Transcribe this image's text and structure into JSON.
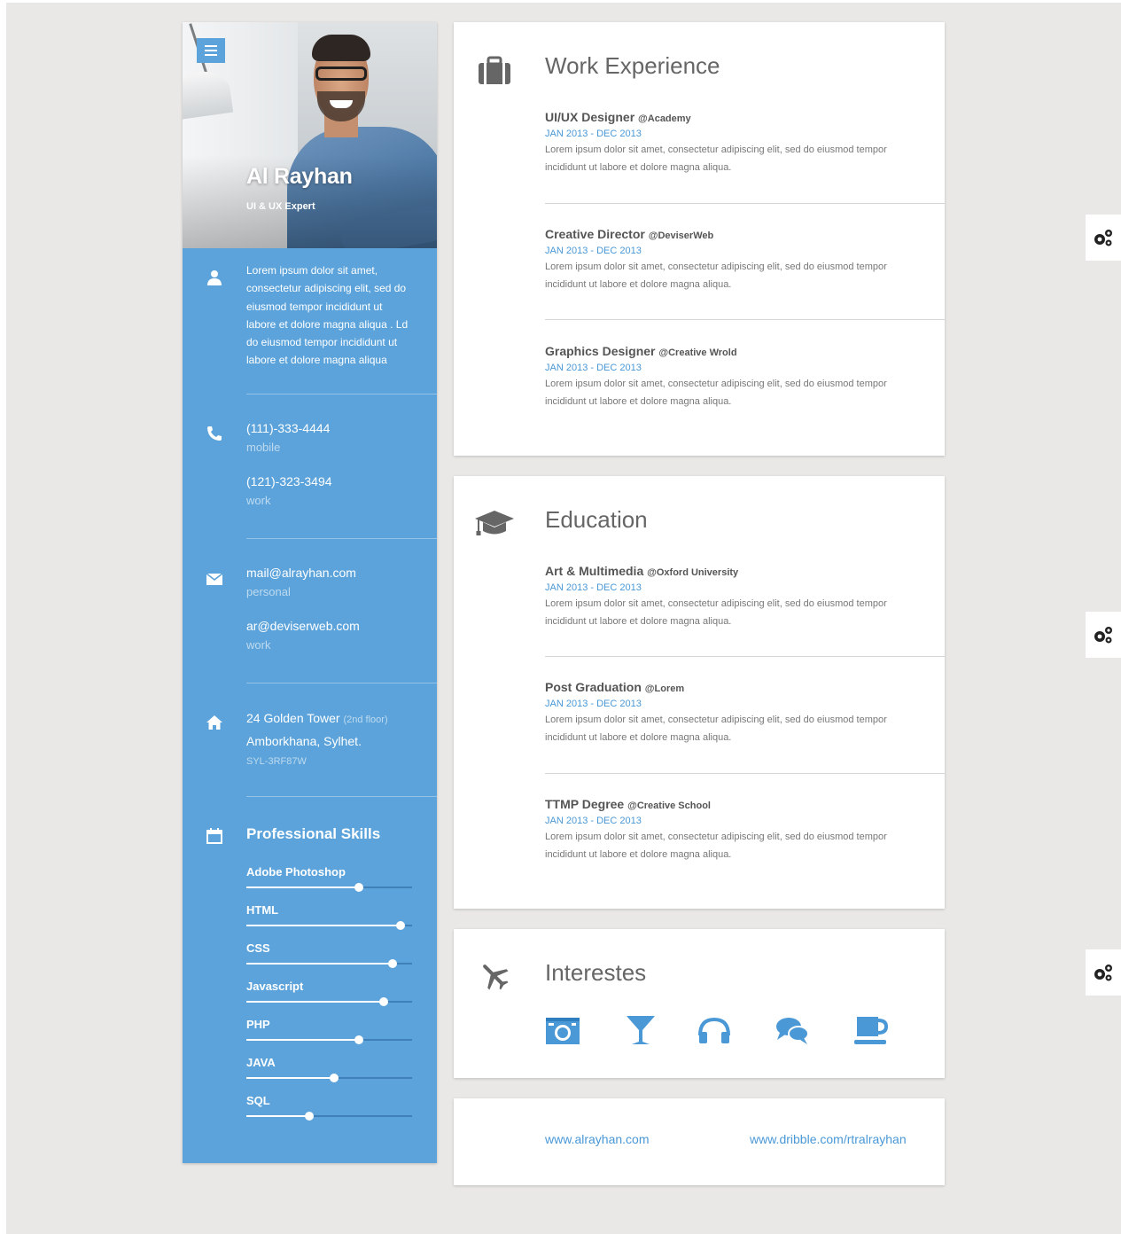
{
  "profile": {
    "name": "Al Rayhan",
    "role": "UI & UX Expert",
    "about": "Lorem ipsum dolor sit amet, consectetur adipiscing elit, sed do eiusmod tempor incididunt ut labore et dolore magna aliqua . Ld do eiusmod tempor incididunt ut labore et dolore magna aliqua"
  },
  "contacts": {
    "phones": [
      {
        "number": "(111)-333-4444",
        "type": "mobile"
      },
      {
        "number": "(121)-323-3494",
        "type": "work"
      }
    ],
    "emails": [
      {
        "address": "mail@alrayhan.com",
        "type": "personal"
      },
      {
        "address": "ar@deviserweb.com",
        "type": "work"
      }
    ],
    "address": {
      "line1": "24 Golden Tower",
      "floor": "(2nd floor)",
      "line2": "Amborkhana, Sylhet.",
      "code": "SYL-3RF87W"
    }
  },
  "skills": {
    "title": "Professional Skills",
    "items": [
      {
        "name": "Adobe Photoshop",
        "level": 0.68
      },
      {
        "name": "HTML",
        "level": 0.93
      },
      {
        "name": "CSS",
        "level": 0.88
      },
      {
        "name": "Javascript",
        "level": 0.83
      },
      {
        "name": "PHP",
        "level": 0.68
      },
      {
        "name": "JAVA",
        "level": 0.53
      },
      {
        "name": "SQL",
        "level": 0.38
      }
    ]
  },
  "work": {
    "title": "Work Experience",
    "entries": [
      {
        "title": "UI/UX Designer",
        "org": "@Academy",
        "date": "JAN 2013 - DEC 2013",
        "desc": "Lorem ipsum dolor sit amet, consectetur adipiscing elit, sed do eiusmod tempor incididunt ut labore et dolore magna aliqua."
      },
      {
        "title": "Creative Director",
        "org": "@DeviserWeb",
        "date": "JAN 2013 - DEC 2013",
        "desc": "Lorem ipsum dolor sit amet, consectetur adipiscing elit, sed do eiusmod tempor incididunt ut labore et dolore magna aliqua."
      },
      {
        "title": "Graphics Designer",
        "org": "@Creative Wrold",
        "date": "JAN 2013 - DEC 2013",
        "desc": "Lorem ipsum dolor sit amet, consectetur adipiscing elit, sed do eiusmod tempor incididunt ut labore et dolore magna aliqua."
      }
    ]
  },
  "education": {
    "title": "Education",
    "entries": [
      {
        "title": "Art & Multimedia",
        "org": "@Oxford University",
        "date": "JAN 2013 - DEC 2013",
        "desc": "Lorem ipsum dolor sit amet, consectetur adipiscing elit, sed do eiusmod tempor incididunt ut labore et dolore magna aliqua."
      },
      {
        "title": "Post Graduation",
        "org": "@Lorem",
        "date": "JAN 2013 - DEC 2013",
        "desc": "Lorem ipsum dolor sit amet, consectetur adipiscing elit, sed do eiusmod tempor incididunt ut labore et dolore magna aliqua."
      },
      {
        "title": "TTMP Degree",
        "org": "@Creative School",
        "date": "JAN 2013 - DEC 2013",
        "desc": "Lorem ipsum dolor sit amet, consectetur adipiscing elit, sed do eiusmod tempor incididunt ut labore et dolore magna aliqua."
      }
    ]
  },
  "interests": {
    "title": "Interestes",
    "icons": [
      "camera-icon",
      "cocktail-icon",
      "headphones-icon",
      "chat-icon",
      "coffee-icon"
    ]
  },
  "links": {
    "website": "www.alrayhan.com",
    "dribbble": "www.dribble.com/rtralrayhan"
  },
  "colors": {
    "accent": "#5ba3da",
    "link": "#4a98d6",
    "background": "#e9e8e6",
    "icon_gray": "#666666"
  },
  "side_tools": [
    "gears-icon",
    "gears-icon",
    "gears-icon"
  ]
}
